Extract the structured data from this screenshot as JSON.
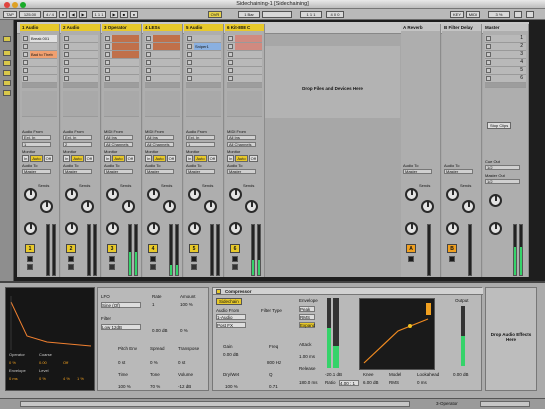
{
  "window": {
    "title": "Sidechaining-1  [Sidechaining]"
  },
  "transport": {
    "tap": "TAP",
    "tempo": "125.00",
    "signature": "4 / 4",
    "quantize": "1 Bar",
    "ovr": "OVR",
    "midi_map": "KEY",
    "cpu": "MIDI"
  },
  "tracks": [
    {
      "name": "1 Audio",
      "color": "#e8c92a",
      "num": "1",
      "clips": [
        [
          "Break 001",
          "#e0e0e0"
        ],
        [
          "",
          ""
        ],
        [
          "Bad to Theb",
          "#f0a070"
        ],
        [
          "",
          ""
        ],
        [
          "",
          ""
        ],
        [
          "",
          ""
        ]
      ],
      "in": "Ext. In",
      "in2": "1",
      "mon": "Auto",
      "out": "Master",
      "meter": 0.0
    },
    {
      "name": "2 Audio",
      "color": "#e8c92a",
      "num": "2",
      "clips": [
        [
          "",
          ""
        ],
        [
          "",
          ""
        ],
        [
          "",
          ""
        ],
        [
          "",
          ""
        ],
        [
          "",
          ""
        ],
        [
          "",
          ""
        ]
      ],
      "in": "Ext. In",
      "in2": "2",
      "mon": "Auto",
      "out": "Master",
      "meter": 0.0
    },
    {
      "name": "3 Operator",
      "color": "#e8c92a",
      "num": "3",
      "clips": [
        [
          "",
          "#c0704a"
        ],
        [
          "",
          "#c0704a"
        ],
        [
          "",
          "#c0704a"
        ],
        [
          "",
          ""
        ],
        [
          "",
          ""
        ],
        [
          "",
          ""
        ]
      ],
      "in": "All Ins",
      "in2": "All Channels",
      "mon": "Auto",
      "out": "Master",
      "meter": 0.45
    },
    {
      "name": "4 LESs",
      "color": "#e8c92a",
      "num": "4",
      "clips": [
        [
          "",
          "#c0704a"
        ],
        [
          "",
          "#c0704a"
        ],
        [
          "",
          ""
        ],
        [
          "",
          ""
        ],
        [
          "",
          ""
        ],
        [
          "",
          ""
        ]
      ],
      "in": "All Ins",
      "in2": "All Channels",
      "mon": "Auto",
      "out": "Master",
      "meter": 0.2
    },
    {
      "name": "5 Audio",
      "color": "#e8c92a",
      "num": "5",
      "clips": [
        [
          "",
          ""
        ],
        [
          "Sniper1",
          "#8ab0e0"
        ],
        [
          "",
          ""
        ],
        [
          "",
          ""
        ],
        [
          "",
          ""
        ],
        [
          "",
          ""
        ]
      ],
      "in": "Ext. In",
      "in2": "1",
      "mon": "Auto",
      "out": "Master",
      "meter": 0.0
    },
    {
      "name": "6 Kit-808 C",
      "color": "#e8c92a",
      "num": "6",
      "clips": [
        [
          "",
          "#d08a80"
        ],
        [
          "",
          "#d08a80"
        ],
        [
          "",
          ""
        ],
        [
          "",
          ""
        ],
        [
          "",
          ""
        ],
        [
          "",
          ""
        ]
      ],
      "in": "All Ins",
      "in2": "All Channels",
      "mon": "Auto",
      "out": "Master",
      "meter": 0.3
    }
  ],
  "drop_area": "Drop Files and Devices Here",
  "returns": [
    {
      "name": "A Reverb",
      "num": "A",
      "out": "Master",
      "meter": 0.0
    },
    {
      "name": "B Filter Delay",
      "num": "B",
      "out": "Master",
      "meter": 0.0
    }
  ],
  "master": {
    "name": "Master",
    "stop_clips": "Stop Clips",
    "cue_out": "Cue Out",
    "master_out": "Master Out",
    "scenes": [
      "1",
      "2",
      "3",
      "4",
      "5",
      "6"
    ],
    "meter": 0.55
  },
  "labels": {
    "audio_from": "Audio From",
    "midi_from": "MIDI From",
    "monitor": "Monitor",
    "audio_to": "Audio To",
    "sends": "Sends",
    "in": "In",
    "auto": "Auto",
    "off": "Off"
  },
  "device": {
    "compressor_title": "Compressor",
    "sidechain": "Sidechain",
    "audio_from": "Audio From",
    "audio_from_value": "1-Audio",
    "post_fx": "Post FX",
    "filter_type": "Filter Type",
    "gain": "Gain",
    "gain_value": "0.00 dB",
    "freq": "Freq",
    "freq_value": "800 Hz",
    "q": "Q",
    "q_value": "0.71",
    "dry_wet": "Dry/Wet",
    "dry_wet_value": "100 %",
    "envelope": "Envelope",
    "peak": "Peak",
    "rms": "RMS",
    "expand": "Expand",
    "attack": "Attack",
    "attack_value": "1.00 ms",
    "release": "Release",
    "release_value": "180.0 ms",
    "threshold_value": "-20.1 dB",
    "ratio": "Ratio",
    "ratio_value": "4.00 : 1",
    "knee": "Knee",
    "knee_value": "6.00 dB",
    "model": "Model",
    "lookahead": "Lookahead",
    "lookahead_value": "0 ms",
    "output": "Output",
    "output_value": "0.00 dB",
    "drop_hint": "Drop Audio Effects Here",
    "op_lfo": "LFO",
    "op_filter": "Filter",
    "op_rate": "Rate",
    "op_amount": "Amount",
    "op_pitch_env": "Pitch Env",
    "op_spread": "Spread",
    "op_transpose": "Transpose",
    "op_time": "Time",
    "op_tone": "Tone",
    "op_volume": "Volume",
    "op_tones": [
      "Sine (Of)",
      "Low 12dB"
    ],
    "op_values": [
      "1",
      "100 %",
      "0.00 dB",
      "0 %",
      "0 st",
      "0 %",
      "100 %",
      "70 %",
      "-12 dB"
    ],
    "op_envs": [
      "Operator",
      "Coarse",
      "Fixed",
      "Envelope",
      "Level"
    ],
    "op_env_vals": [
      "0 %",
      "0.00",
      "Off",
      "0 ms",
      "0 %",
      "0 %",
      "4 %",
      "1 %"
    ]
  },
  "status": {
    "track_label": "3-Operator"
  }
}
